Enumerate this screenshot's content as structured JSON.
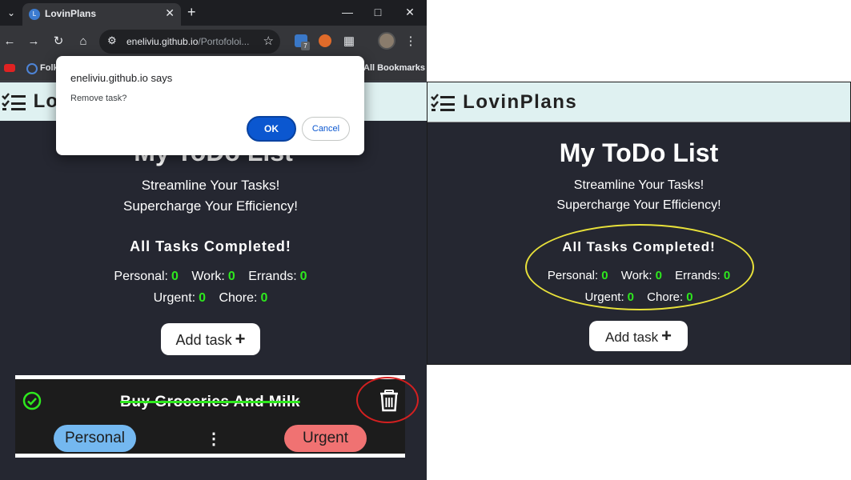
{
  "browser": {
    "tab_title": "LovinPlans",
    "tab_favicon": "L",
    "tab_close": "✕",
    "new_tab": "+",
    "url_host": "eneliviu.github.io",
    "url_path": "/Portofoloi...",
    "bookmarks": {
      "folder_label": "Folk",
      "all_bookmarks": "All Bookmarks"
    },
    "extension_badge": "7"
  },
  "dialog": {
    "title": "eneliviu.github.io says",
    "message": "Remove task?",
    "ok_label": "OK",
    "cancel_label": "Cancel"
  },
  "app_left": {
    "brand": "Lo",
    "title": "My ToDo List",
    "tagline_1": "Streamline Your Tasks!",
    "tagline_2": "Supercharge Your Efficiency!",
    "status": "All Tasks Completed!",
    "counts": {
      "personal_label": "Personal:",
      "personal": "0",
      "work_label": "Work:",
      "work": "0",
      "errands_label": "Errands:",
      "errands": "0",
      "urgent_label": "Urgent:",
      "urgent": "0",
      "chore_label": "Chore:",
      "chore": "0"
    },
    "add_task_label": "Add task",
    "add_task_plus": "+",
    "task": {
      "title": "Buy Groceries And Milk",
      "completed": true,
      "category": "Personal",
      "priority": "Urgent",
      "menu_glyph": "⋮"
    }
  },
  "app_right": {
    "brand": "LovinPlans",
    "title": "My ToDo List",
    "tagline_1": "Streamline Your Tasks!",
    "tagline_2": "Supercharge Your Efficiency!",
    "status": "All Tasks Completed!",
    "counts": {
      "personal_label": "Personal:",
      "personal": "0",
      "work_label": "Work:",
      "work": "0",
      "errands_label": "Errands:",
      "errands": "0",
      "urgent_label": "Urgent:",
      "urgent": "0",
      "chore_label": "Chore:",
      "chore": "0"
    },
    "add_task_label": "Add task",
    "add_task_plus": "+"
  },
  "colors": {
    "app_bg": "#252731",
    "header_bg": "#dff1f1",
    "count_value": "#2ee81e",
    "pill_personal": "#74b8f0",
    "pill_urgent": "#f07272",
    "highlight_ellipse": "#e8e13a",
    "highlight_circle": "#d42020",
    "dialog_ok": "#0b57d0"
  },
  "icons": {
    "brand": "checklist-icon",
    "task_check": "check-circle-icon",
    "delete": "trash-icon"
  }
}
